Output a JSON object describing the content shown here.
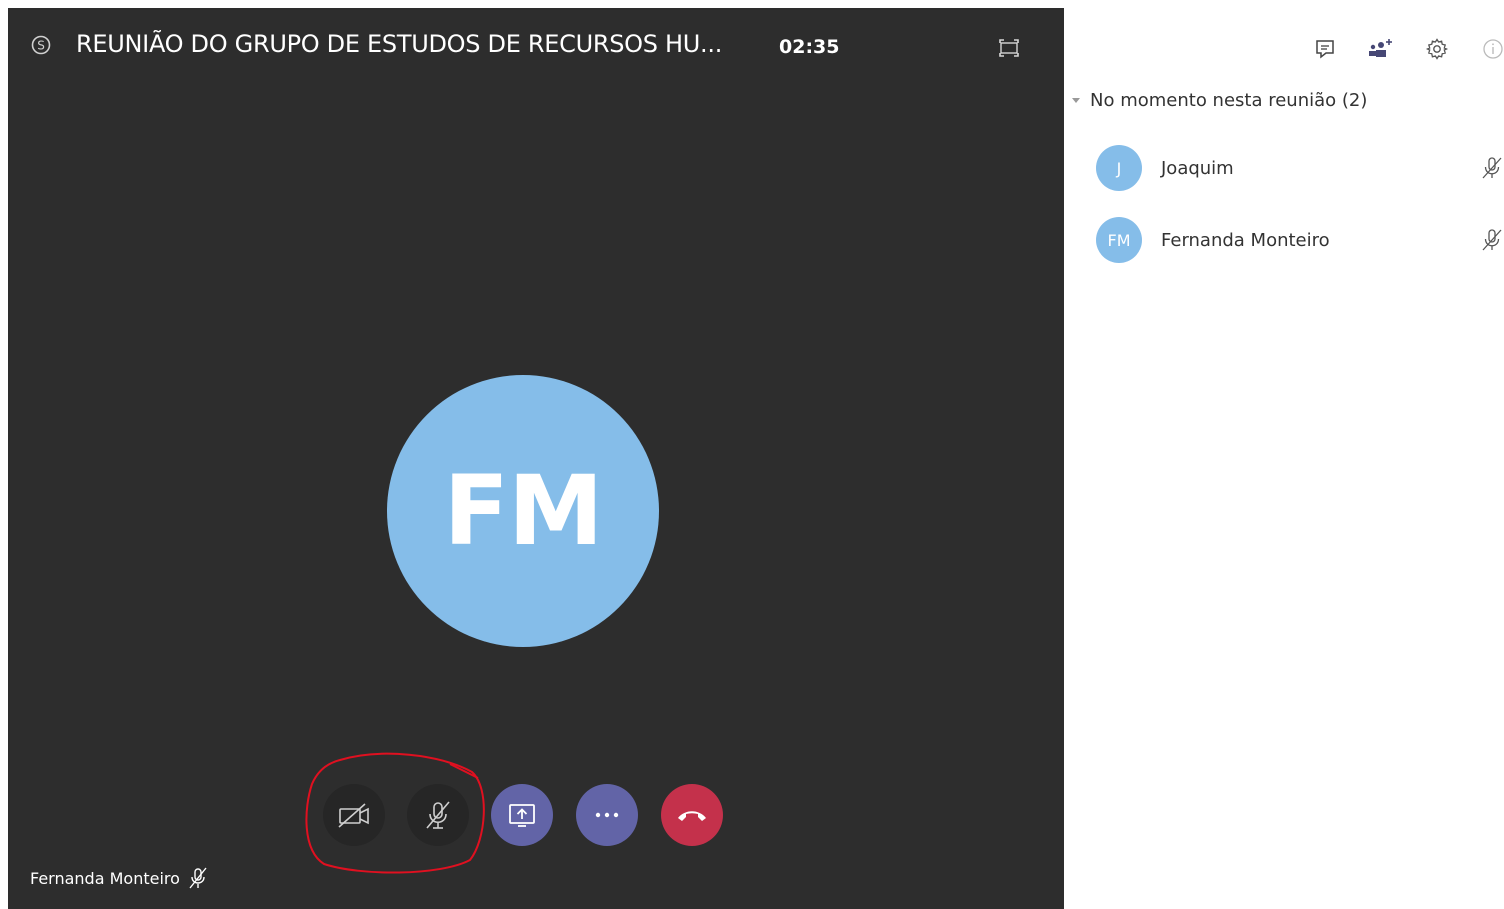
{
  "meeting": {
    "title": "REUNIÃO DO GRUPO DE ESTUDOS DE RECURSOS HU...",
    "timer": "02:35",
    "main_avatar_initials": "FM",
    "self_label": "Fernanda Monteiro"
  },
  "icons": {
    "app_logo": "skype-logo-icon",
    "fullscreen": "fullscreen-icon",
    "camera_off": "camera-off-icon",
    "mic_off": "microphone-off-icon",
    "share": "share-screen-icon",
    "more": "more-options-icon",
    "hangup": "hang-up-icon",
    "chat": "chat-icon",
    "add_people": "add-participants-icon",
    "settings": "gear-icon",
    "info": "info-icon"
  },
  "panel": {
    "section_label": "No momento nesta reunião (2)",
    "participants": [
      {
        "initials": "J",
        "name": "Joaquim",
        "muted": true
      },
      {
        "initials": "FM",
        "name": "Fernanda Monteiro",
        "muted": true
      }
    ]
  },
  "colors": {
    "stage_bg": "#2d2d2d",
    "avatar_blue": "#85bde9",
    "purple_button": "#6264a7",
    "hangup_red": "#c4314b",
    "annotation_red": "#e01020"
  }
}
